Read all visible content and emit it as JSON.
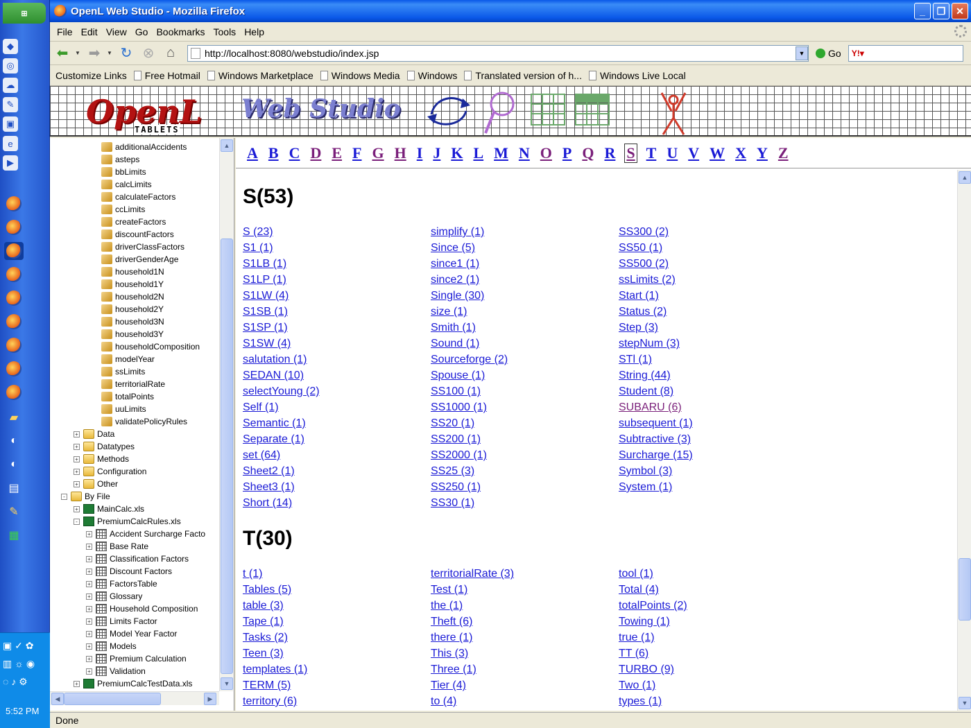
{
  "window": {
    "title": "OpenL Web Studio - Mozilla Firefox"
  },
  "menu": [
    "File",
    "Edit",
    "View",
    "Go",
    "Bookmarks",
    "Tools",
    "Help"
  ],
  "address": {
    "url": "http://localhost:8080/webstudio/index.jsp",
    "go_label": "Go"
  },
  "bookmarks": [
    "Customize Links",
    "Free Hotmail",
    "Windows Marketplace",
    "Windows Media",
    "Windows",
    "Translated version of h...",
    "Windows Live Local"
  ],
  "banner": {
    "logo": "OpenL",
    "logo_sub": "TABLETS",
    "app_name": "Web Studio"
  },
  "clock": "5:52 PM",
  "status": "Done",
  "tree": [
    {
      "label": "additionalAccidents",
      "icon": "rule",
      "indent": 3
    },
    {
      "label": "asteps",
      "icon": "rule",
      "indent": 3
    },
    {
      "label": "bbLimits",
      "icon": "rule",
      "indent": 3
    },
    {
      "label": "calcLimits",
      "icon": "rule",
      "indent": 3
    },
    {
      "label": "calculateFactors",
      "icon": "rule",
      "indent": 3
    },
    {
      "label": "ccLimits",
      "icon": "rule",
      "indent": 3
    },
    {
      "label": "createFactors",
      "icon": "rule",
      "indent": 3
    },
    {
      "label": "discountFactors",
      "icon": "rule",
      "indent": 3
    },
    {
      "label": "driverClassFactors",
      "icon": "rule",
      "indent": 3
    },
    {
      "label": "driverGenderAge",
      "icon": "rule",
      "indent": 3
    },
    {
      "label": "household1N",
      "icon": "rule",
      "indent": 3
    },
    {
      "label": "household1Y",
      "icon": "rule",
      "indent": 3
    },
    {
      "label": "household2N",
      "icon": "rule",
      "indent": 3
    },
    {
      "label": "household2Y",
      "icon": "rule",
      "indent": 3
    },
    {
      "label": "household3N",
      "icon": "rule",
      "indent": 3
    },
    {
      "label": "household3Y",
      "icon": "rule",
      "indent": 3
    },
    {
      "label": "householdComposition",
      "icon": "rule",
      "indent": 3
    },
    {
      "label": "modelYear",
      "icon": "rule",
      "indent": 3
    },
    {
      "label": "ssLimits",
      "icon": "rule",
      "indent": 3
    },
    {
      "label": "territorialRate",
      "icon": "rule",
      "indent": 3
    },
    {
      "label": "totalPoints",
      "icon": "rule",
      "indent": 3
    },
    {
      "label": "uuLimits",
      "icon": "rule",
      "indent": 3
    },
    {
      "label": "validatePolicyRules",
      "icon": "rule",
      "indent": 3
    },
    {
      "label": "Data",
      "icon": "folder",
      "indent": 2,
      "exp": "+"
    },
    {
      "label": "Datatypes",
      "icon": "folder",
      "indent": 2,
      "exp": "+"
    },
    {
      "label": "Methods",
      "icon": "folder",
      "indent": 2,
      "exp": "+"
    },
    {
      "label": "Configuration",
      "icon": "folder",
      "indent": 2,
      "exp": "+"
    },
    {
      "label": "Other",
      "icon": "folder",
      "indent": 2,
      "exp": "+"
    },
    {
      "label": "By File",
      "icon": "folder",
      "indent": 1,
      "exp": "-"
    },
    {
      "label": "MainCalc.xls",
      "icon": "xls",
      "indent": 2,
      "exp": "+"
    },
    {
      "label": "PremiumCalcRules.xls",
      "icon": "xls",
      "indent": 2,
      "exp": "-"
    },
    {
      "label": "Accident Surcharge Facto",
      "icon": "table",
      "indent": 3,
      "exp": "+"
    },
    {
      "label": "Base Rate",
      "icon": "table",
      "indent": 3,
      "exp": "+"
    },
    {
      "label": "Classification Factors",
      "icon": "table",
      "indent": 3,
      "exp": "+"
    },
    {
      "label": "Discount Factors",
      "icon": "table",
      "indent": 3,
      "exp": "+"
    },
    {
      "label": "FactorsTable",
      "icon": "table",
      "indent": 3,
      "exp": "+"
    },
    {
      "label": "Glossary",
      "icon": "table",
      "indent": 3,
      "exp": "+"
    },
    {
      "label": "Household Composition",
      "icon": "table",
      "indent": 3,
      "exp": "+"
    },
    {
      "label": "Limits Factor",
      "icon": "table",
      "indent": 3,
      "exp": "+"
    },
    {
      "label": "Model Year Factor",
      "icon": "table",
      "indent": 3,
      "exp": "+"
    },
    {
      "label": "Models",
      "icon": "table",
      "indent": 3,
      "exp": "+"
    },
    {
      "label": "Premium Calculation",
      "icon": "table",
      "indent": 3,
      "exp": "+"
    },
    {
      "label": "Validation",
      "icon": "table",
      "indent": 3,
      "exp": "+"
    },
    {
      "label": "PremiumCalcTestData.xls",
      "icon": "xls",
      "indent": 2,
      "exp": "+"
    }
  ],
  "alphabet": [
    {
      "letter": "A",
      "state": "link"
    },
    {
      "letter": "B",
      "state": "link"
    },
    {
      "letter": "C",
      "state": "link"
    },
    {
      "letter": "D",
      "state": "visited"
    },
    {
      "letter": "E",
      "state": "visited"
    },
    {
      "letter": "F",
      "state": "link"
    },
    {
      "letter": "G",
      "state": "visited"
    },
    {
      "letter": "H",
      "state": "visited"
    },
    {
      "letter": "I",
      "state": "link"
    },
    {
      "letter": "J",
      "state": "link"
    },
    {
      "letter": "K",
      "state": "link"
    },
    {
      "letter": "L",
      "state": "link"
    },
    {
      "letter": "M",
      "state": "link"
    },
    {
      "letter": "N",
      "state": "link"
    },
    {
      "letter": "O",
      "state": "visited"
    },
    {
      "letter": "P",
      "state": "link"
    },
    {
      "letter": "Q",
      "state": "visited"
    },
    {
      "letter": "R",
      "state": "link"
    },
    {
      "letter": "S",
      "state": "active"
    },
    {
      "letter": "T",
      "state": "link"
    },
    {
      "letter": "U",
      "state": "link"
    },
    {
      "letter": "V",
      "state": "link"
    },
    {
      "letter": "W",
      "state": "link"
    },
    {
      "letter": "X",
      "state": "link"
    },
    {
      "letter": "Y",
      "state": "link"
    },
    {
      "letter": "Z",
      "state": "visited"
    }
  ],
  "sections": [
    {
      "heading": "S(53)",
      "columns": [
        [
          "S (23)",
          "S1 (1)",
          "S1LB (1)",
          "S1LP (1)",
          "S1LW (4)",
          "S1SB (1)",
          "S1SP (1)",
          "S1SW (4)",
          "salutation (1)",
          "SEDAN (10)",
          "selectYoung (2)",
          "Self (1)",
          "Semantic (1)",
          "Separate (1)",
          "set (64)",
          "Sheet2 (1)",
          "Sheet3 (1)",
          "Short (14)"
        ],
        [
          "simplify (1)",
          "Since (5)",
          "since1 (1)",
          "since2 (1)",
          "Single (30)",
          "size (1)",
          "Smith (1)",
          "Sound (1)",
          "Sourceforge (2)",
          "Spouse (1)",
          "SS100 (1)",
          "SS1000 (1)",
          "SS20 (1)",
          "SS200 (1)",
          "SS2000 (1)",
          "SS25 (3)",
          "SS250 (1)",
          "SS30 (1)"
        ],
        [
          "SS300 (2)",
          "SS50 (1)",
          "SS500 (2)",
          "ssLimits (2)",
          "Start (1)",
          "Status (2)",
          "Step (3)",
          "stepNum (3)",
          "STl (1)",
          "String (44)",
          "Student (8)",
          "SUBARU (6)",
          "subsequent (1)",
          "Subtractive (3)",
          "Surcharge (15)",
          "Symbol (3)",
          "System (1)"
        ]
      ],
      "visited": [
        "SUBARU (6)"
      ]
    },
    {
      "heading": "T(30)",
      "columns": [
        [
          "t (1)",
          "Tables (5)",
          "table (3)",
          "Tape (1)",
          "Tasks (2)",
          "Teen (3)",
          "templates (1)",
          "TERM (5)",
          "territory (6)"
        ],
        [
          "territorialRate (3)",
          "Test (1)",
          "the (1)",
          "Theft (6)",
          "there (1)",
          "This (3)",
          "Three (1)",
          "Tier (4)",
          "to (4)"
        ],
        [
          "tool (1)",
          "Total (4)",
          "totalPoints (2)",
          "Towing (1)",
          "true (1)",
          "TT (6)",
          "TURBO (9)",
          "Two (1)",
          "types (1)"
        ]
      ],
      "visited": []
    }
  ],
  "colors": {
    "link": "#1a1ad6",
    "visited": "#7a1f7a",
    "logo": "#b31212",
    "app_name": "#7b7fd0"
  }
}
